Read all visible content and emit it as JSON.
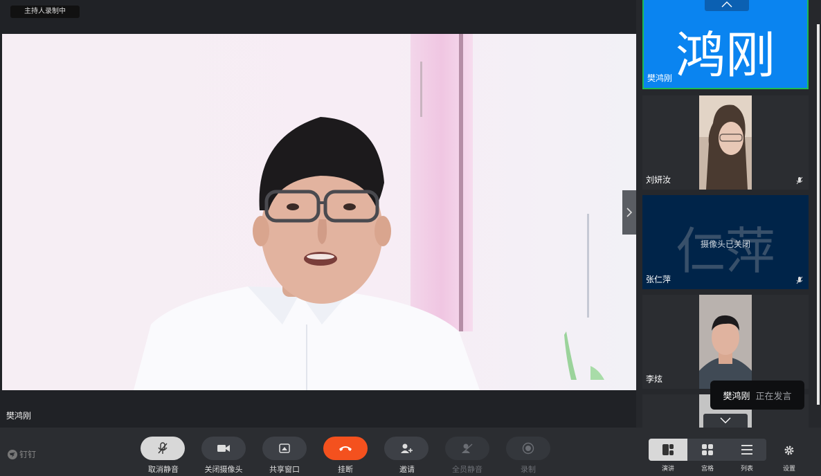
{
  "recording_badge": "主持人录制中",
  "main_video": {
    "speaker_name": "樊鸿刚"
  },
  "participants": [
    {
      "name": "樊鸿刚",
      "avatar_text": "鸿刚"
    },
    {
      "name": "刘妍汝"
    },
    {
      "name": "张仁萍",
      "avatar_text": "仁萍",
      "camera_status": "摄像头已关闭"
    },
    {
      "name": "李炫"
    }
  ],
  "speaking_toast": {
    "name": "樊鸿刚",
    "status": "正在发言"
  },
  "brand": {
    "label": "钉钉"
  },
  "toolbar": {
    "unmute": "取消静音",
    "camera_off": "关闭摄像头",
    "share": "共享窗口",
    "hangup": "挂断",
    "invite": "邀请",
    "mute_all": "全员静音",
    "record": "录制"
  },
  "layout": {
    "speaker": "演讲",
    "grid": "宫格",
    "list": "列表",
    "settings": "设置"
  },
  "colors": {
    "active_tile": "#0a84f0",
    "active_border": "#1db954",
    "hangup": "#f4511e",
    "camera_off_tile": "#002449"
  }
}
